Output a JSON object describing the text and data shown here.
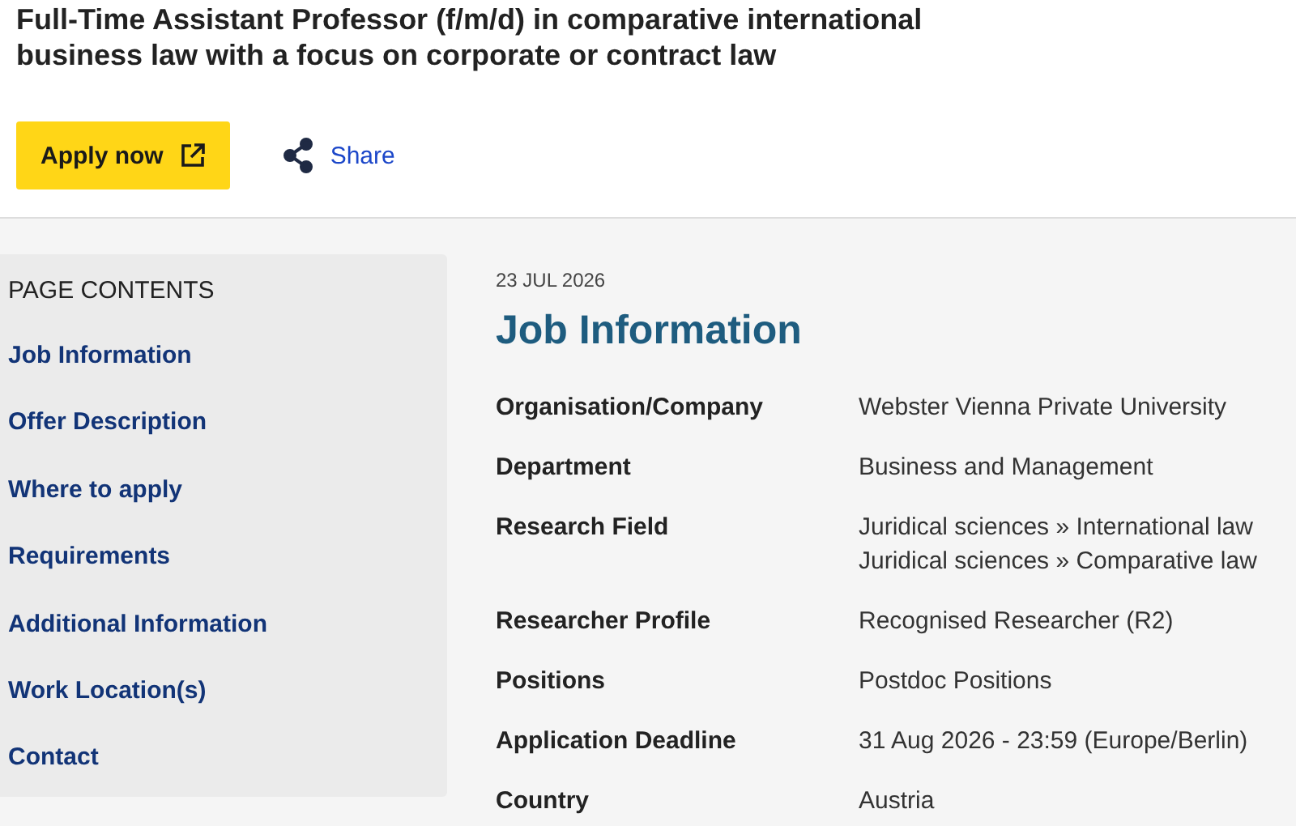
{
  "title": "Full-Time Assistant Professor (f/m/d) in comparative international business law with a focus on corporate or contract law",
  "apply_button": "Apply now",
  "share_link": "Share",
  "page_contents": {
    "heading": "PAGE CONTENTS",
    "items": [
      "Job Information",
      "Offer Description",
      "Where to apply",
      "Requirements",
      "Additional Information",
      "Work Location(s)",
      "Contact"
    ]
  },
  "date": "23 JUL 2026",
  "section_title": "Job Information",
  "fields": [
    {
      "label": "Organisation/Company",
      "values": [
        "Webster Vienna Private University"
      ]
    },
    {
      "label": "Department",
      "values": [
        "Business and Management"
      ]
    },
    {
      "label": "Research Field",
      "values": [
        "Juridical sciences » International law",
        "Juridical sciences » Comparative law"
      ]
    },
    {
      "label": "Researcher Profile",
      "values": [
        "Recognised Researcher (R2)"
      ]
    },
    {
      "label": "Positions",
      "values": [
        "Postdoc Positions"
      ]
    },
    {
      "label": "Application Deadline",
      "values": [
        "31 Aug 2026 - 23:59 (Europe/Berlin)"
      ]
    },
    {
      "label": "Country",
      "values": [
        "Austria"
      ]
    }
  ]
}
